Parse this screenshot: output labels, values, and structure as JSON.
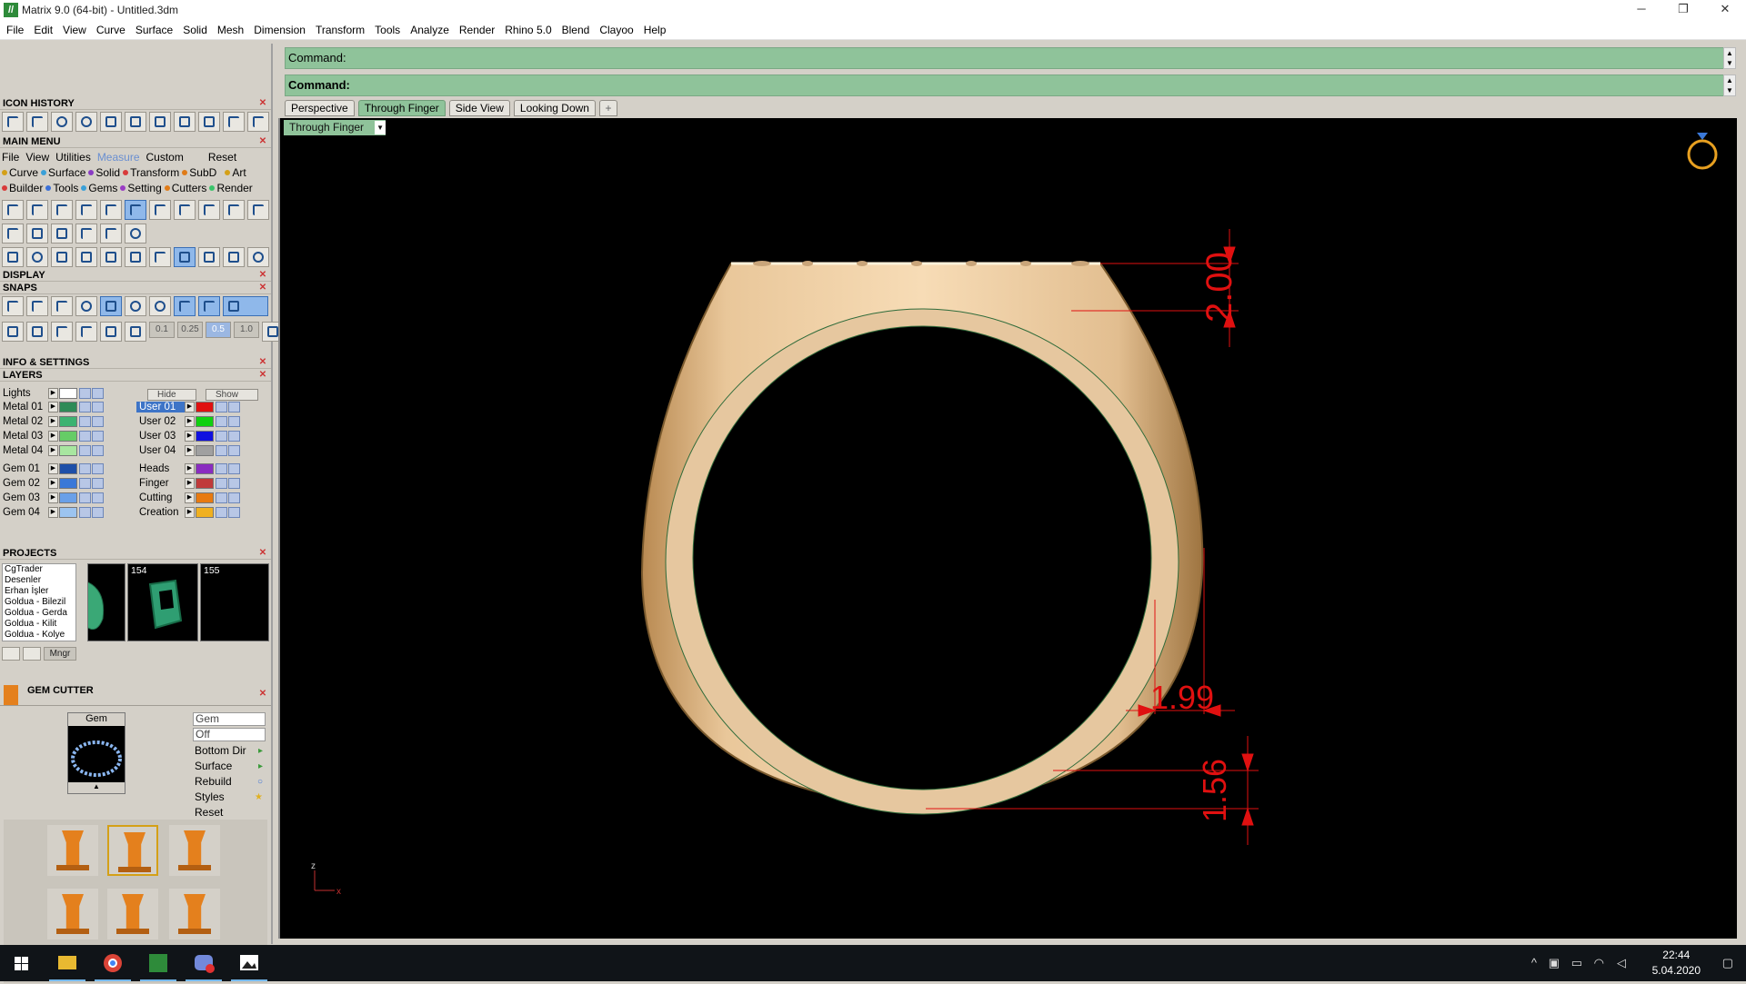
{
  "window": {
    "title": "Matrix 9.0 (64-bit) - Untitled.3dm",
    "app_icon": "matrix-icon"
  },
  "menubar": [
    "File",
    "Edit",
    "View",
    "Curve",
    "Surface",
    "Solid",
    "Mesh",
    "Dimension",
    "Transform",
    "Tools",
    "Analyze",
    "Render",
    "Rhino 5.0",
    "Blend",
    "Clayoo",
    "Help"
  ],
  "panels": {
    "icon_history": "ICON HISTORY",
    "main_menu": "MAIN MENU",
    "display": "DISPLAY",
    "snaps": "SNAPS",
    "info_settings": "INFO & SETTINGS",
    "layers": "LAYERS",
    "projects": "PROJECTS",
    "gem_cutter": "GEM CUTTER"
  },
  "main_menu": {
    "tabs": [
      "File",
      "View",
      "Utilities",
      "Measure",
      "Custom"
    ],
    "reset": "Reset",
    "categories_row1": [
      {
        "label": "Curve",
        "color": "#d4a017"
      },
      {
        "label": "Surface",
        "color": "#3aa0d8"
      },
      {
        "label": "Solid",
        "color": "#8a3cc4"
      },
      {
        "label": "Transform",
        "color": "#d83a3a"
      },
      {
        "label": "SubD",
        "color": "#e07b17"
      },
      {
        "label": "Art",
        "color": "#d4a017"
      }
    ],
    "categories_row2": [
      {
        "label": "Builder",
        "color": "#d83a3a"
      },
      {
        "label": "Tools",
        "color": "#3a70d8"
      },
      {
        "label": "Gems",
        "color": "#3aa0d8"
      },
      {
        "label": "Setting",
        "color": "#9a3cc4"
      },
      {
        "label": "Cutters",
        "color": "#e07b17"
      },
      {
        "label": "Render",
        "color": "#3ac46a"
      }
    ]
  },
  "snaps": {
    "values": [
      "0.1",
      "0.25",
      "0.5",
      "1.0"
    ]
  },
  "layers": {
    "lights": "Lights",
    "hide": "Hide",
    "show": "Show",
    "left": [
      {
        "name": "Metal 01",
        "color": "#2e8b57"
      },
      {
        "name": "Metal 02",
        "color": "#3cb371"
      },
      {
        "name": "Metal 03",
        "color": "#66cc66"
      },
      {
        "name": "Metal 04",
        "color": "#a8e6a0"
      },
      {
        "name": "Gem 01",
        "color": "#1e4fa8"
      },
      {
        "name": "Gem 02",
        "color": "#3a78d8"
      },
      {
        "name": "Gem 03",
        "color": "#6aa0e8"
      },
      {
        "name": "Gem 04",
        "color": "#9cc4f0"
      }
    ],
    "right": [
      {
        "name": "User 01",
        "color": "#e01010"
      },
      {
        "name": "User 02",
        "color": "#10d010"
      },
      {
        "name": "User 03",
        "color": "#1010e0"
      },
      {
        "name": "User 04",
        "color": "#a0a0a0"
      },
      {
        "name": "Heads",
        "color": "#8a2cc0"
      },
      {
        "name": "Finger",
        "color": "#c03a3a"
      },
      {
        "name": "Cutting",
        "color": "#e87a10"
      },
      {
        "name": "Creation",
        "color": "#f0b020"
      }
    ]
  },
  "projects": {
    "list": [
      "CgTrader",
      "Desenler",
      "Erhan İşler",
      "Goldua - Bilezil",
      "Goldua - Gerda",
      "Goldua - Kilit",
      "Goldua - Kolye"
    ],
    "thumbs": [
      "154",
      "155"
    ],
    "mngr": "Mngr"
  },
  "gem_cutter": {
    "preview_label": "Gem",
    "fields": [
      "Gem",
      "Off"
    ],
    "items": [
      "Bottom Dir",
      "Surface",
      "Rebuild",
      "Styles",
      "Reset"
    ]
  },
  "command": {
    "line1": "Command:",
    "line2": "Command:"
  },
  "viewport_tabs": [
    "Perspective",
    "Through Finger",
    "Side View",
    "Looking Down"
  ],
  "viewport": {
    "label": "Through Finger",
    "dims": [
      "2.00",
      "1.99",
      "1.56"
    ],
    "axes": {
      "z": "z",
      "x": "x"
    },
    "colors": {
      "metal": "#f3d3a8",
      "dimension": "#e01010",
      "background": "#000000"
    }
  },
  "taskbar": {
    "time": "22:44",
    "date": "5.04.2020"
  }
}
